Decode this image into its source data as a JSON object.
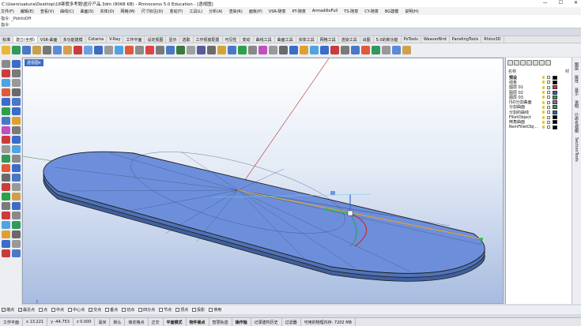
{
  "titlebar": {
    "title": "C:\\Users\\sakura\\Desktop\\18寒假多考题\\医疗产品.3dm (8068 KB) - Rhinoceros 5.0 Education - [透视图]",
    "min": "—",
    "max": "☐",
    "close": "✕"
  },
  "menubar": [
    "文件(F)",
    "编辑(E)",
    "查看(V)",
    "曲线(C)",
    "曲面(S)",
    "实体(O)",
    "网格(M)",
    "尺寸标注(D)",
    "变动(T)",
    "工具(L)",
    "分析(A)",
    "渲染(R)",
    "面板(P)",
    "VSR-随意",
    "PT-随意",
    "ArmadilloFull",
    "TS-随意",
    "CY-随意",
    "BG建模",
    "说明(H)"
  ],
  "command": {
    "history": "指令: _PointsOff",
    "prompt": "指令:"
  },
  "tabs": [
    "标准",
    "建立(全部)",
    "VSR-曲面",
    "多功能建模",
    "Cotama",
    "V-Ray",
    "工作平面",
    "设定视图",
    "显示",
    "选取",
    "工作视窗配置",
    "可见性",
    "变动",
    "曲线工具",
    "曲面工具",
    "实体工具",
    "网格工具",
    "渲染工具",
    "出图",
    "5.0的新功能",
    "PoTools",
    "WeaverBird",
    "PanelingTools",
    "Rhino3D"
  ],
  "viewport": {
    "label": "透视图▾"
  },
  "layers": {
    "header_name": "名称",
    "header_right": "材",
    "items": [
      {
        "name": "预设",
        "color": "#000000"
      },
      {
        "name": "线条",
        "color": "#000000"
      },
      {
        "name": "图层 01",
        "color": "#d8342c"
      },
      {
        "name": "图层 02",
        "color": "#2b5fd1"
      },
      {
        "name": "图层 03",
        "color": "#2aa14a"
      },
      {
        "name": "ISO分割曲面",
        "color": "#c14fbd"
      },
      {
        "name": "分割曲面",
        "color": "#2aa14a"
      },
      {
        "name": "分割的曲线",
        "color": "#2b5fd1"
      },
      {
        "name": "FilletObject",
        "color": "#000000"
      },
      {
        "name": "倒角曲面",
        "color": "#000000"
      },
      {
        "name": "RemFilletObj...",
        "color": "#000000"
      }
    ]
  },
  "sidetabs": [
    "图层",
    "属性",
    "显示",
    "说明",
    "已命名视图",
    "SectionTools"
  ],
  "osnap": [
    {
      "label": "端点",
      "checked": true
    },
    {
      "label": "最近点",
      "checked": true
    },
    {
      "label": "点",
      "checked": false
    },
    {
      "label": "中点",
      "checked": false
    },
    {
      "label": "中心点",
      "checked": false
    },
    {
      "label": "交点",
      "checked": true
    },
    {
      "label": "垂点",
      "checked": false
    },
    {
      "label": "切点",
      "checked": false
    },
    {
      "label": "四分点",
      "checked": false
    },
    {
      "label": "节点",
      "checked": false
    },
    {
      "label": "顶点",
      "checked": false
    },
    {
      "label": "投影",
      "checked": false
    },
    {
      "label": "停用",
      "checked": false
    }
  ],
  "status": {
    "cplane": "工作平面",
    "x": "x 13.221",
    "y": "y -44.753",
    "z": "z 0.000",
    "unit": "毫米",
    "layer": "默认",
    "grid_snap": "锁定格点",
    "ortho": "正交",
    "planar": "平面模式",
    "osnap": "物件锁点",
    "smart_track": "智慧轨迹",
    "gumball": "操作轴",
    "record_history": "记录建构历史",
    "filter": "过滤器",
    "memory": "可用的物理内存: 7202 MB"
  },
  "colors": {
    "accent": "#3a6cc9",
    "body": "#4f7de0",
    "orange": "#f0a020",
    "green": "#22c33a"
  }
}
